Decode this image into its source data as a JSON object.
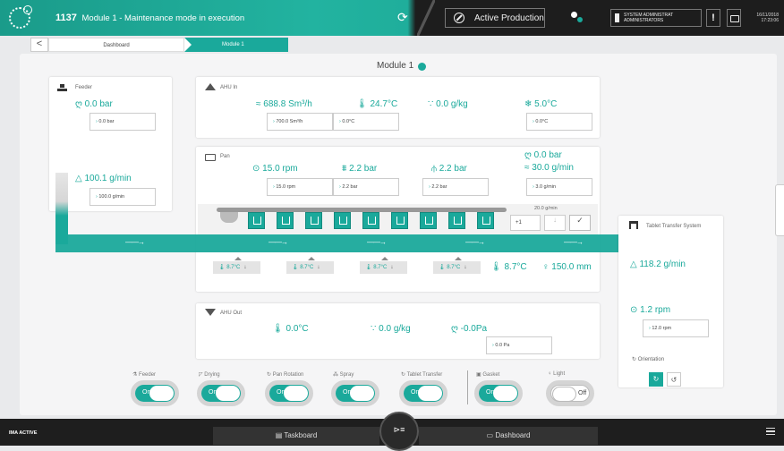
{
  "header": {
    "machine_id": "1137",
    "title": "Module 1 - Maintenance mode in execution",
    "production_status": "Active Production",
    "user_role": "SYSTEM ADMINISTRAT",
    "user_group": "ADMINISTRATORS",
    "date": "16/11/2018",
    "time": "17:23:06",
    "alert_label": "!"
  },
  "breadcrumb": {
    "back": "<",
    "items": [
      "Dashboard",
      "Module 1"
    ]
  },
  "module": {
    "title": "Module 1",
    "status_color": "#1aa99b"
  },
  "feeder": {
    "label": "Feeder",
    "pressure": "0.0 bar",
    "pressure_set": "0.0 bar",
    "flow": "100.1 g/min",
    "flow_set": "100.0 g/min"
  },
  "ahu_in": {
    "label": "AHU In",
    "airflow": "688.8 Sm³/h",
    "airflow_set": "700.0 Sm³/h",
    "temperature": "24.7°C",
    "temperature_set": "0.0°C",
    "humidity": "0.0 g/kg",
    "dewpoint": "5.0°C",
    "dewpoint_set": "0.0°C"
  },
  "pan": {
    "label": "Pan",
    "speed": "15.0 rpm",
    "speed_set": "15.0 rpm",
    "pressure1": "2.2 bar",
    "pressure1_set": "2.2 bar",
    "pressure2": "2.2 bar",
    "pressure2_set": "2.2 bar",
    "pressure3": "0.0 bar",
    "spray_flow": "30.0 g/min",
    "spray_flow_set": "3.0 g/min",
    "spray_flow_small": "20.0 g/min",
    "step": "+1",
    "nozzle_count": 9,
    "sensors": [
      "8.7°C",
      "8.7°C",
      "8.7°C",
      "8.7°C"
    ],
    "bed_temperature": "8.7°C",
    "bed_distance": "150.0 mm"
  },
  "ahu_out": {
    "label": "AHU Out",
    "temperature": "0.0°C",
    "humidity": "0.0 g/kg",
    "pressure": "-0.0Pa",
    "pressure_set": "0.0 Pa"
  },
  "tablet_transfer": {
    "label": "Tablet Transfer System",
    "flow": "118.2 g/min",
    "speed": "1.2 rpm",
    "speed_set": "12.0 rpm",
    "orientation_label": "Orientation"
  },
  "controls": [
    {
      "label": "Feeder",
      "state": "On"
    },
    {
      "label": "Drying",
      "state": "On"
    },
    {
      "label": "Pan Rotation",
      "state": "On"
    },
    {
      "label": "Spray",
      "state": "On"
    },
    {
      "label": "Tablet Transfer",
      "state": "On"
    },
    {
      "label": "Gasket",
      "state": "On"
    },
    {
      "label": "Light",
      "state": "Off"
    }
  ],
  "footer": {
    "brand": "IMA ACTIVE",
    "taskboard": "Taskboard",
    "dashboard": "Dashboard"
  },
  "colors": {
    "accent": "#1aa99b",
    "dark": "#1d1d1d"
  }
}
